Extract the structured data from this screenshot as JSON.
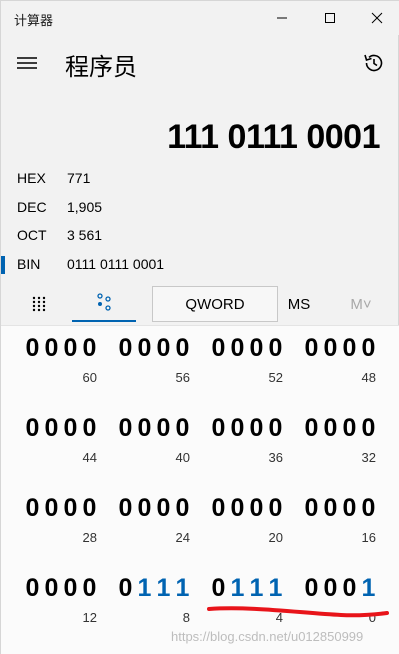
{
  "titlebar": {
    "app_title": "计算器"
  },
  "header": {
    "mode_title": "程序员"
  },
  "display": {
    "value": "111 0111 0001"
  },
  "radix": [
    {
      "label": "HEX",
      "value": "771",
      "selected": false
    },
    {
      "label": "DEC",
      "value": "1,905",
      "selected": false
    },
    {
      "label": "OCT",
      "value": "3 561",
      "selected": false
    },
    {
      "label": "BIN",
      "value": "0111 0111 0001",
      "selected": true
    }
  ],
  "toolbar": {
    "word_size": "QWORD",
    "ms": "MS",
    "mplus": "M˅"
  },
  "bitpad": {
    "rows": [
      {
        "nibbles": [
          "0000",
          "0000",
          "0000",
          "0000"
        ],
        "positions": [
          "60",
          "56",
          "52",
          "48"
        ]
      },
      {
        "nibbles": [
          "0000",
          "0000",
          "0000",
          "0000"
        ],
        "positions": [
          "44",
          "40",
          "36",
          "32"
        ]
      },
      {
        "nibbles": [
          "0000",
          "0000",
          "0000",
          "0000"
        ],
        "positions": [
          "28",
          "24",
          "20",
          "16"
        ]
      },
      {
        "nibbles": [
          "0000",
          "0111",
          "0111",
          "0001"
        ],
        "positions": [
          "12",
          "8",
          "4",
          "0"
        ]
      }
    ]
  },
  "colors": {
    "accent": "#0063b1",
    "annotation_red": "#e8141a"
  },
  "watermark": "https://blog.csdn.net/u012850999"
}
